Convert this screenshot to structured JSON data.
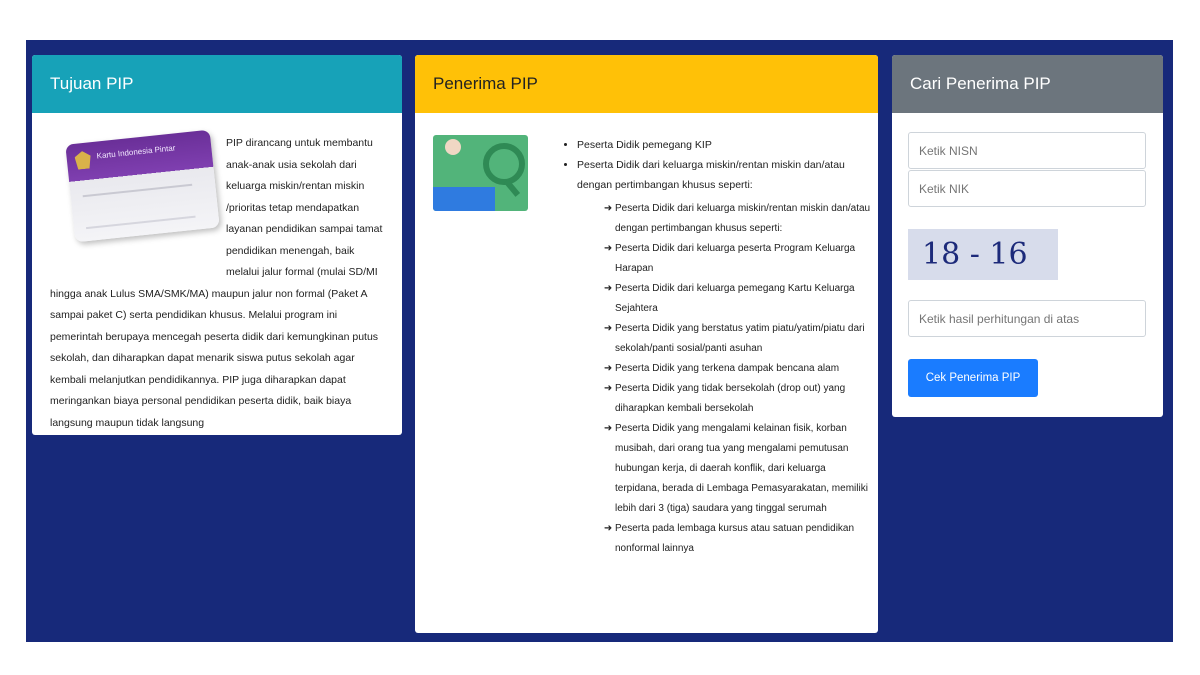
{
  "cards": {
    "tujuan": {
      "title": "Tujuan PIP",
      "kip_card_label": "Kartu Indonesia Pintar",
      "text": "PIP dirancang untuk membantu anak-anak usia sekolah dari keluarga miskin/rentan miskin /prioritas tetap mendapatkan layanan pendidikan sampai tamat pendidikan menengah, baik melalui jalur formal (mulai SD/MI hingga anak Lulus SMA/SMK/MA) maupun jalur non formal (Paket A sampai paket C) serta pendidikan khusus. Melalui program ini pemerintah berupaya mencegah peserta didik dari kemungkinan putus sekolah, dan diharapkan dapat menarik siswa putus sekolah agar kembali melanjutkan pendidikannya. PIP juga diharapkan dapat meringankan biaya personal pendidikan peserta didik, baik biaya langsung maupun tidak langsung"
    },
    "penerima": {
      "title": "Penerima PIP",
      "items": [
        {
          "text": "Peserta Didik pemegang KIP",
          "sub": []
        },
        {
          "text": "Peserta Didik dari keluarga miskin/rentan miskin dan/atau dengan pertimbangan khusus seperti:",
          "sub": [
            "Peserta Didik dari keluarga miskin/rentan miskin dan/atau dengan pertimbangan khusus seperti:",
            "Peserta Didik dari keluarga peserta Program Keluarga Harapan",
            "Peserta Didik dari keluarga pemegang Kartu Keluarga Sejahtera",
            "Peserta Didik yang berstatus yatim piatu/yatim/piatu dari sekolah/panti sosial/panti asuhan",
            "Peserta Didik yang terkena dampak bencana alam",
            "Peserta Didik yang tidak bersekolah (drop out) yang diharapkan kembali bersekolah",
            "Peserta Didik yang mengalami kelainan fisik, korban musibah, dari orang tua yang mengalami pemutusan hubungan kerja, di daerah konflik, dari keluarga terpidana, berada di Lembaga Pemasyarakatan, memiliki lebih dari 3 (tiga) saudara yang tinggal serumah",
            "Peserta pada lembaga kursus atau satuan pendidikan nonformal lainnya"
          ]
        }
      ]
    },
    "cari": {
      "title": "Cari Penerima PIP",
      "nisn_placeholder": "Ketik NISN",
      "nik_placeholder": "Ketik NIK",
      "captcha": "18 - 16",
      "hasil_placeholder": "Ketik hasil perhitungan di atas",
      "button_label": "Cek Penerima PIP"
    }
  },
  "colors": {
    "page_bg": "#17297a",
    "tujuan_header": "#17a2b8",
    "penerima_header": "#ffc107",
    "cari_header": "#6c757d",
    "button": "#1a7cff"
  }
}
